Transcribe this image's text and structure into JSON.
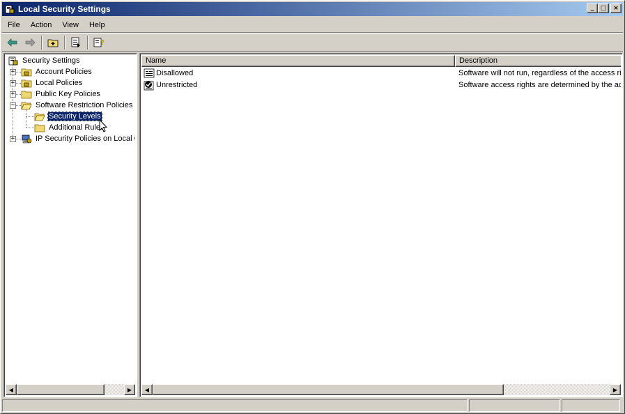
{
  "window": {
    "title": "Local Security Settings",
    "buttons": {
      "minimize": "_",
      "maximize": "□",
      "close": "×"
    }
  },
  "menu": [
    "File",
    "Action",
    "View",
    "Help"
  ],
  "toolbar": {
    "icons": [
      "back-arrow-icon",
      "forward-arrow-icon",
      "up-folder-icon",
      "export-list-icon",
      "help-icon"
    ]
  },
  "tree": {
    "root": "Security Settings",
    "items": [
      {
        "label": "Account Policies",
        "expander": "+"
      },
      {
        "label": "Local Policies",
        "expander": "+"
      },
      {
        "label": "Public Key Policies",
        "expander": "+"
      },
      {
        "label": "Software Restriction Policies",
        "expander": "−"
      },
      {
        "label": "Security Levels",
        "selected": true
      },
      {
        "label": "Additional Rules"
      },
      {
        "label": "IP Security Policies on Local Co",
        "expander": "+"
      }
    ]
  },
  "list": {
    "columns": [
      "Name",
      "Description"
    ],
    "rows": [
      {
        "name": "Disallowed",
        "description": "Software will not run, regardless of the access rig"
      },
      {
        "name": "Unrestricted",
        "description": "Software access rights are determined by the acc"
      }
    ]
  },
  "status": {
    "panels": [
      "",
      "",
      ""
    ]
  },
  "colors": {
    "title_start": "#0a246a",
    "title_end": "#a6caf0",
    "selection": "#0a246a",
    "face": "#d4d0c8"
  }
}
